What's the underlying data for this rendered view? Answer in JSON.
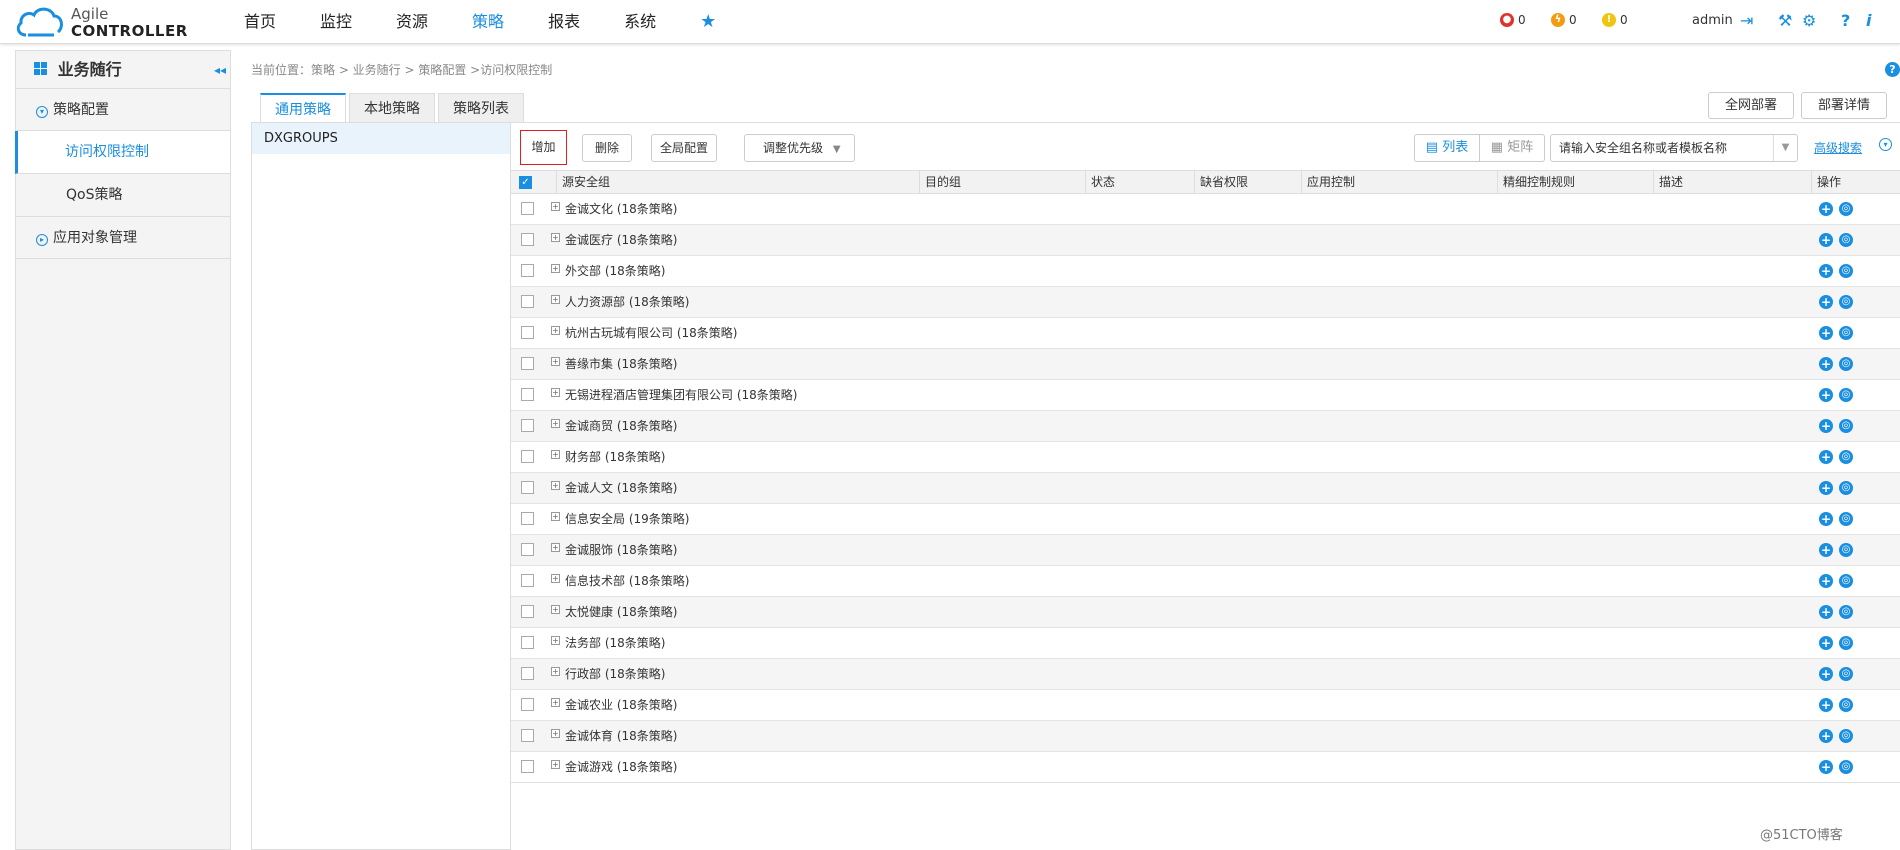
{
  "logo": {
    "line1": "Agile",
    "line2": "CONTROLLER"
  },
  "nav": {
    "items": [
      "首页",
      "监控",
      "资源",
      "策略",
      "报表",
      "系统"
    ],
    "active_index": 3,
    "favorite_glyph": "★"
  },
  "alerts": {
    "critical": "0",
    "major": "0",
    "minor": "0"
  },
  "user": {
    "name": "admin"
  },
  "sidebar": {
    "title": "业务随行",
    "groups": [
      {
        "label": "策略配置",
        "items": [
          "访问权限控制",
          "QoS策略"
        ]
      },
      {
        "label": "应用对象管理",
        "items": []
      }
    ],
    "active_item": "访问权限控制"
  },
  "breadcrumb": "当前位置：策略 > 业务随行 > 策略配置 >访问权限控制",
  "tabs": [
    "通用策略",
    "本地策略",
    "策略列表"
  ],
  "active_tab": 0,
  "deploy": {
    "all": "全网部署",
    "details": "部署详情"
  },
  "group_panel": {
    "items": [
      "DXGROUPS"
    ]
  },
  "toolbar": {
    "add": "增加",
    "delete": "删除",
    "global_config": "全局配置",
    "adjust_priority": "调整优先级",
    "view_list": "列表",
    "view_matrix": "矩阵",
    "search_placeholder": "请输入安全组名称或者模板名称",
    "advanced_search": "高级搜索"
  },
  "table": {
    "columns": [
      "源安全组",
      "目的组",
      "状态",
      "缺省权限",
      "应用控制",
      "精细控制规则",
      "描述",
      "操作"
    ],
    "rows": [
      "金诚文化 (18条策略)",
      "金诚医疗 (18条策略)",
      "外交部 (18条策略)",
      "人力资源部 (18条策略)",
      "杭州古玩城有限公司 (18条策略)",
      "善缘市集 (18条策略)",
      "无锡进程酒店管理集团有限公司 (18条策略)",
      "金诚商贸 (18条策略)",
      "财务部 (18条策略)",
      "金诚人文 (18条策略)",
      "信息安全局 (19条策略)",
      "金诚服饰 (18条策略)",
      "信息技术部 (18条策略)",
      "太悦健康 (18条策略)",
      "法务部 (18条策略)",
      "行政部 (18条策略)",
      "金诚农业 (18条策略)",
      "金诚体育 (18条策略)",
      "金诚游戏 (18条策略)"
    ]
  },
  "watermark": "@51CTO博客",
  "colors": {
    "accent": "#1a8ee0",
    "add_highlight": "#e02020"
  }
}
